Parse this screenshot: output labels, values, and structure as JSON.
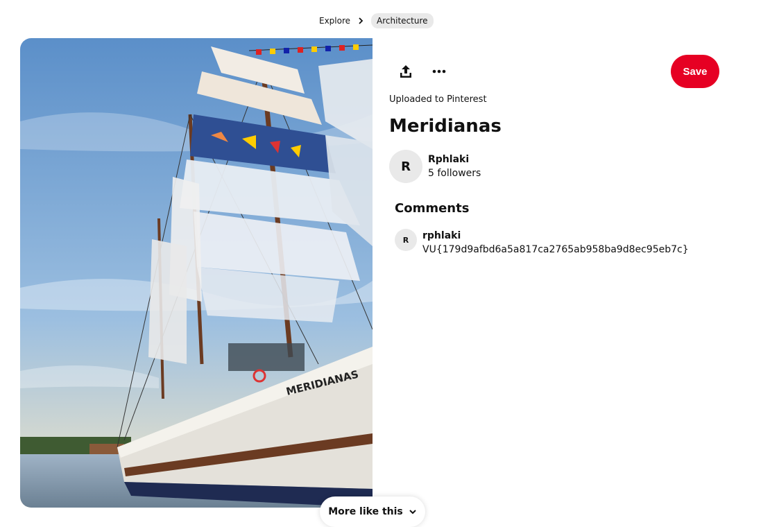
{
  "breadcrumb": {
    "items": [
      "Explore"
    ],
    "current": "Architecture"
  },
  "pin": {
    "uploaded_label": "Uploaded to Pinterest",
    "title": "Meridianas",
    "image_alt": "Tall ship Meridianas with sails",
    "hull_name": "MERIDIANAS"
  },
  "toolbar": {
    "save_label": "Save",
    "share_icon": "share-icon",
    "more_icon": "more-icon"
  },
  "author": {
    "initial": "R",
    "name": "Rphlaki",
    "followers": "5 followers"
  },
  "comments": {
    "heading": "Comments",
    "items": [
      {
        "initial": "R",
        "author": "rphlaki",
        "text": "VU{179d9afbd6a5a817ca2765ab958ba9d8ec95eb7c}"
      }
    ]
  },
  "more_like_this": {
    "label": "More like this"
  },
  "colors": {
    "accent": "#e60023",
    "chip_bg": "#e9e9e9"
  }
}
